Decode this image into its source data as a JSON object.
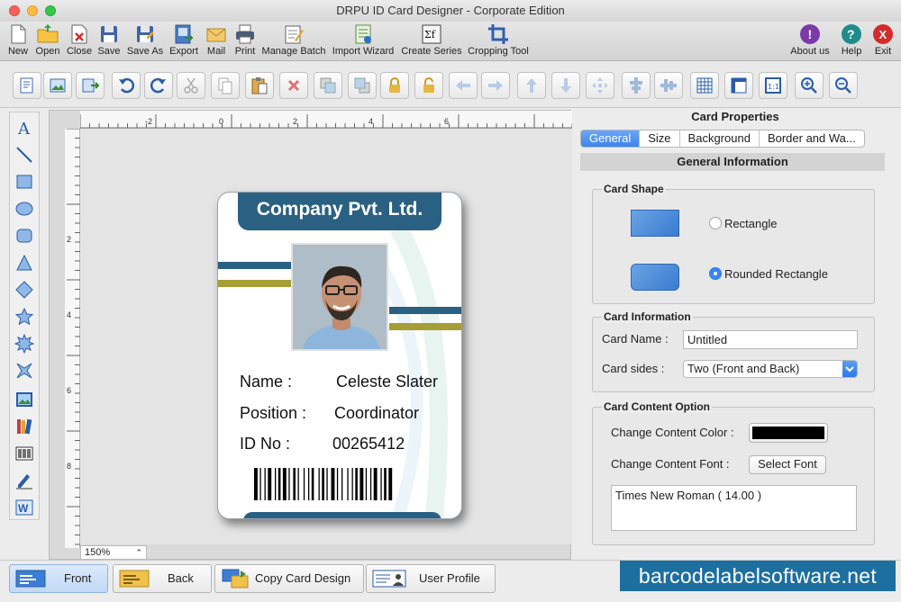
{
  "window": {
    "title": "DRPU ID Card Designer - Corporate Edition"
  },
  "main_toolbar": [
    {
      "label": "New",
      "icon": "new-document-icon"
    },
    {
      "label": "Open",
      "icon": "open-folder-icon"
    },
    {
      "label": "Close",
      "icon": "close-document-icon"
    },
    {
      "label": "Save",
      "icon": "save-icon"
    },
    {
      "label": "Save As",
      "icon": "save-as-icon"
    },
    {
      "label": "Export",
      "icon": "export-icon"
    },
    {
      "label": "Mail",
      "icon": "mail-icon"
    },
    {
      "label": "Print",
      "icon": "print-icon"
    },
    {
      "label": "Manage Batch",
      "icon": "manage-batch-icon"
    },
    {
      "label": "Import Wizard",
      "icon": "import-wizard-icon"
    },
    {
      "label": "Create Series",
      "icon": "create-series-icon"
    },
    {
      "label": "Cropping Tool",
      "icon": "cropping-tool-icon"
    },
    {
      "label": "About us",
      "icon": "about-icon"
    },
    {
      "label": "Help",
      "icon": "help-icon"
    },
    {
      "label": "Exit",
      "icon": "exit-icon"
    }
  ],
  "canvas": {
    "zoom": "150%",
    "ruler_top": [
      "-2",
      "0",
      "2",
      "4",
      "6"
    ],
    "ruler_left": [
      "2",
      "4",
      "6",
      "8"
    ]
  },
  "card": {
    "company": "Company Pvt. Ltd.",
    "fields": [
      {
        "label": "Name :",
        "value": "Celeste Slater"
      },
      {
        "label": "Position :",
        "value": "Coordinator"
      },
      {
        "label": "ID No :",
        "value": "00265412"
      }
    ],
    "header_color": "#2a6082",
    "stripe_blue": "#2a6082",
    "stripe_olive": "#a79d36"
  },
  "properties": {
    "title": "Card Properties",
    "tabs": [
      "General",
      "Size",
      "Background",
      "Border and Wa..."
    ],
    "active_tab": "General",
    "section_title": "General Information",
    "card_shape": {
      "title": "Card Shape",
      "rectangle_label": "Rectangle",
      "rounded_label": "Rounded Rectangle",
      "selected": "Rounded Rectangle"
    },
    "card_information": {
      "title": "Card Information",
      "name_label": "Card Name :",
      "name_value": "Untitled",
      "sides_label": "Card sides :",
      "sides_value": "Two (Front and Back)"
    },
    "content_option": {
      "title": "Card Content Option",
      "color_label": "Change Content Color :",
      "color_value": "#000000",
      "font_label": "Change Content Font :",
      "font_button": "Select Font",
      "font_display": "Times New Roman ( 14.00 )"
    }
  },
  "bottom_bar": {
    "front": "Front",
    "back": "Back",
    "copy_card": "Copy Card Design",
    "user_profile": "User Profile",
    "brand": "barcodelabelsoftware.net"
  }
}
